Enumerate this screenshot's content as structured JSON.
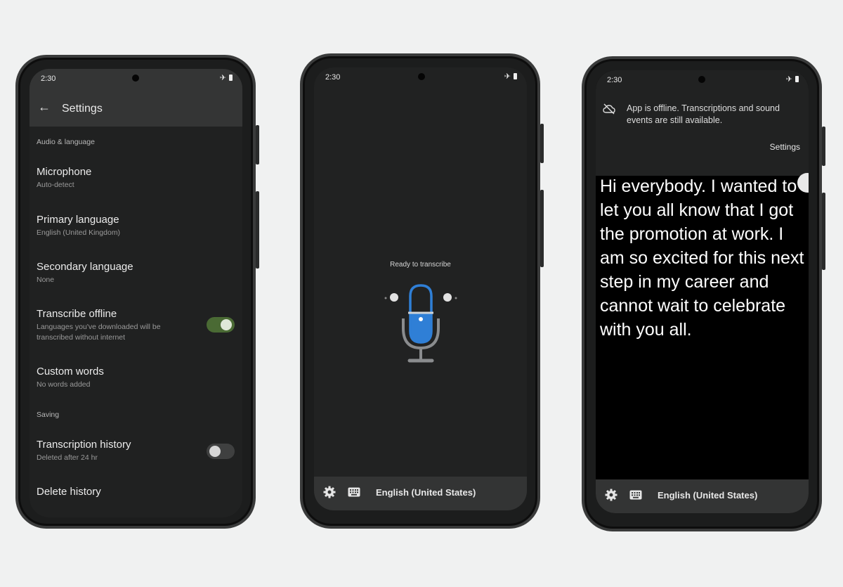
{
  "status": {
    "time": "2:30"
  },
  "settings": {
    "title": "Settings",
    "sections": {
      "audio": "Audio & language",
      "saving": "Saving"
    },
    "items": [
      {
        "title": "Microphone",
        "subtitle": "Auto-detect"
      },
      {
        "title": "Primary language",
        "subtitle": "English (United Kingdom)"
      },
      {
        "title": "Secondary language",
        "subtitle": "None"
      },
      {
        "title": "Transcribe offline",
        "subtitle_line1": "Languages you've downloaded will be",
        "subtitle_line2": "transcribed without internet",
        "toggle": "on"
      },
      {
        "title": "Custom words",
        "subtitle": "No words added"
      },
      {
        "title": "Transcription history",
        "subtitle": "Deleted after 24 hr",
        "toggle": "off"
      },
      {
        "title": "Delete history"
      }
    ]
  },
  "transcribe": {
    "ready_label": "Ready to  transcribe",
    "language": "English (United States)"
  },
  "offline": {
    "message": "App is offline. Transcriptions and sound events are still available.",
    "settings_link": "Settings",
    "caption": "Hi everybody. I wanted to let you all know that I got the promotion at work. I am so excited for this next step in my career and cannot wait to celebrate with you all.",
    "language": "English (United States)"
  },
  "colors": {
    "toggle_on": "#4a6a34",
    "mic_blue": "#2f7fd6",
    "mic_stroke": "#8a8c8e"
  },
  "icons": [
    "back-arrow-icon",
    "airplane-icon",
    "battery-icon",
    "gear-icon",
    "keyboard-icon",
    "microphone-icon",
    "cloud-off-icon"
  ]
}
